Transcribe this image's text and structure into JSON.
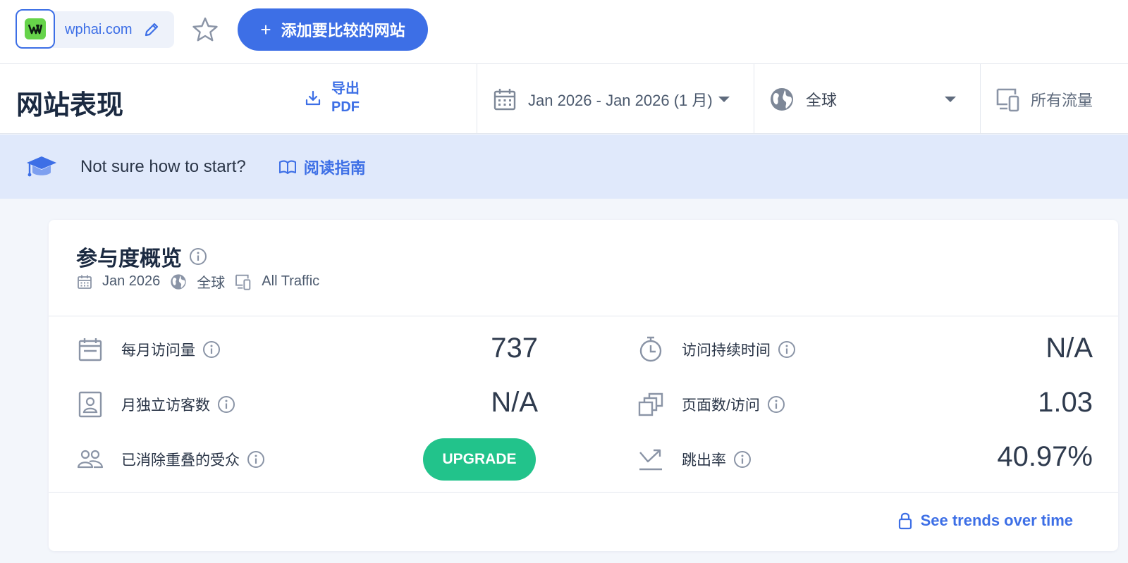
{
  "header": {
    "site_domain": "wphai.com",
    "add_compare_label": "添加要比较的网站",
    "add_compare_icon": "+",
    "accent_color": "#3d6fe6",
    "favicon_color": "#66d34a"
  },
  "filters": {
    "page_title": "网站表现",
    "export_line1": "导出",
    "export_line2": "PDF",
    "date_range": "Jan 2026 - Jan 2026 (1 月)",
    "region": "全球",
    "traffic": "所有流量"
  },
  "banner": {
    "message": "Not sure how to start?",
    "guide_label": "阅读指南"
  },
  "overview": {
    "title": "参与度概览",
    "meta_date": "Jan 2026",
    "meta_region": "全球",
    "meta_traffic": "All Traffic",
    "metrics_left": [
      {
        "label": "每月访问量",
        "value": "737",
        "icon": "calendar-icon"
      },
      {
        "label": "月独立访客数",
        "value": "N/A",
        "icon": "visitor-id-icon"
      },
      {
        "label": "已消除重叠的受众",
        "value": "UPGRADE",
        "icon": "audience-icon"
      }
    ],
    "metrics_right": [
      {
        "label": "访问持续时间",
        "value": "N/A",
        "icon": "stopwatch-icon"
      },
      {
        "label": "页面数/访问",
        "value": "1.03",
        "icon": "pages-icon"
      },
      {
        "label": "跳出率",
        "value": "40.97%",
        "icon": "bounce-icon"
      }
    ],
    "upgrade_color": "#22c38b",
    "trends_label": "See trends over time"
  }
}
